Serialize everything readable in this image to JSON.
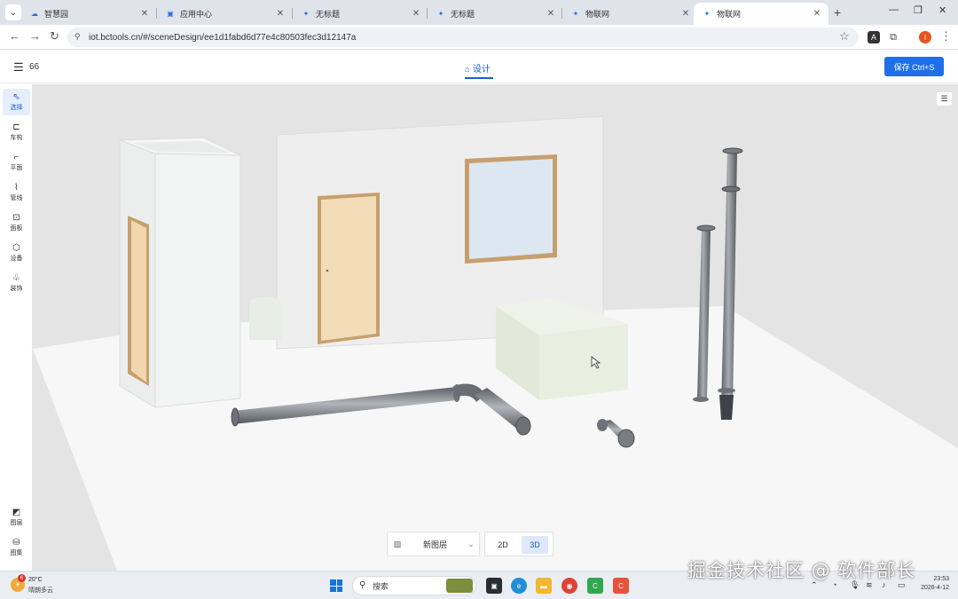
{
  "browser": {
    "tabs": [
      {
        "label": "智慧园",
        "icon": "cloud-icon"
      },
      {
        "label": "应用中心",
        "icon": "app-icon"
      },
      {
        "label": "无标题",
        "icon": "cube-icon"
      },
      {
        "label": "无标题",
        "icon": "cube-icon"
      },
      {
        "label": "物联网",
        "icon": "cube-icon"
      },
      {
        "label": "物联网",
        "icon": "cube-icon",
        "active": true
      }
    ],
    "url": "iot.bctools.cn/#/sceneDesign/ee1d1fabd6d77e4c80503fec3d12147a",
    "profile_initial": "I"
  },
  "header": {
    "project_title": "66",
    "mode_tab": "设计",
    "save_label": "保存 Ctrl+S"
  },
  "toolbar": {
    "items": [
      {
        "label": "选择",
        "icon": "select-cursor-icon",
        "active": true
      },
      {
        "label": "车构",
        "icon": "structure-icon"
      },
      {
        "label": "平面",
        "icon": "plane-icon"
      },
      {
        "label": "管线",
        "icon": "pipeline-icon"
      },
      {
        "label": "面板",
        "icon": "panel-icon"
      },
      {
        "label": "设备",
        "icon": "device-icon"
      },
      {
        "label": "装饰",
        "icon": "decoration-icon"
      }
    ],
    "bottom": [
      {
        "label": "图层",
        "icon": "chart-icon"
      },
      {
        "label": "图集",
        "icon": "gallery-icon"
      }
    ]
  },
  "viewport": {
    "layer_select": "新图层",
    "view_modes": [
      "2D",
      "3D"
    ],
    "active_view": "3D"
  },
  "taskbar": {
    "weather_temp": "20°C",
    "weather_desc": "晴朗多云",
    "weather_badge": "6",
    "search_placeholder": "搜索",
    "time": "23:53",
    "date": "2026-4-12"
  },
  "overlay_watermark": "掘金技术社区 @ 软件部长",
  "colors": {
    "accent": "#1e6fe8",
    "viewport_bg": "#e4e4e4",
    "floor": "#f7f7f7",
    "door": "#f3dcb8",
    "pipe": "#8a8e93"
  }
}
